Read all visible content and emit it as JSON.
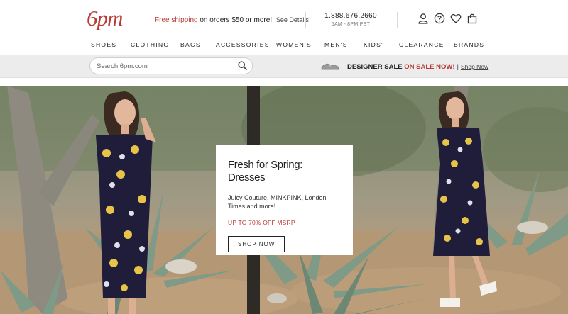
{
  "brand": {
    "logo_text": "6pm",
    "accent_color": "#b73a35"
  },
  "promo": {
    "free_shipping": "Free shipping",
    "rest": " on orders $50 or more!",
    "details_link": "See Details"
  },
  "contact": {
    "phone": "1.888.676.2660",
    "hours": "6AM - 8PM PST"
  },
  "user_icons": [
    "account-icon",
    "help-icon",
    "heart-icon",
    "bag-icon"
  ],
  "nav": {
    "items": [
      {
        "label": "SHOES"
      },
      {
        "label": "CLOTHING"
      },
      {
        "label": "BAGS"
      },
      {
        "label": "ACCESSORIES"
      },
      {
        "label": "WOMEN'S"
      },
      {
        "label": "MEN'S"
      },
      {
        "label": "KIDS'"
      },
      {
        "label": "CLEARANCE"
      },
      {
        "label": "BRANDS"
      }
    ]
  },
  "search": {
    "placeholder": "Search 6pm.com"
  },
  "designer_banner": {
    "lead": "DESIGNER SALE ",
    "highlight": "ON SALE NOW!",
    "divider": "|",
    "link": "Shop Now"
  },
  "hero": {
    "title": "Fresh for Spring: Dresses",
    "subtitle": "Juicy Couture, MINKPINK, London Times and more!",
    "offer": "UP TO 70% OFF MSRP",
    "cta": "SHOP NOW"
  }
}
